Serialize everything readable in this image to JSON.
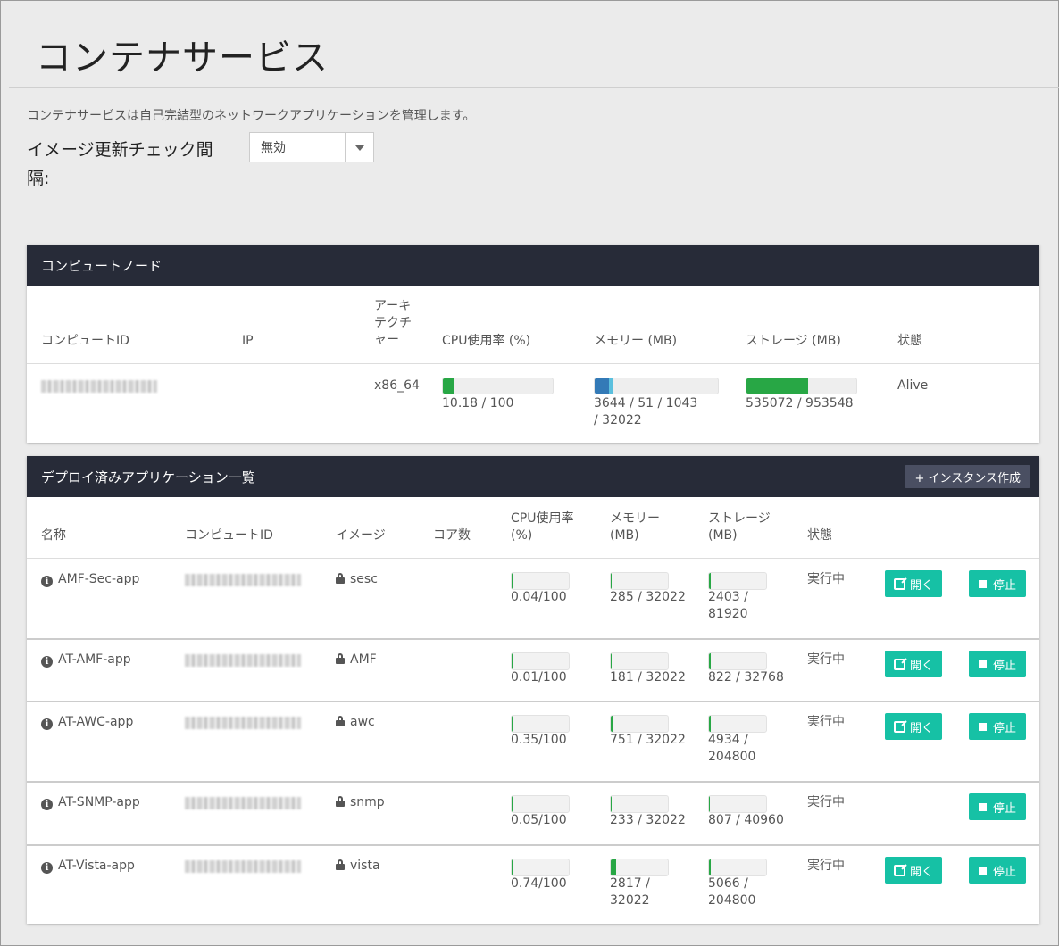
{
  "page": {
    "title": "コンテナサービス",
    "description": "コンテナサービスは自己完結型のネットワークアプリケーションを管理します。",
    "interval_label": "イメージ更新チェック間隔:",
    "interval_value": "無効"
  },
  "compute": {
    "title": "コンピュートノード",
    "headers": {
      "id": "コンピュートID",
      "ip": "IP",
      "arch": "アーキテクチャー",
      "cpu": "CPU使用率 (%)",
      "memory": "メモリー (MB)",
      "storage": "ストレージ (MB)",
      "status": "状態"
    },
    "node": {
      "arch": "x86_64",
      "cpu_text": "10.18 / 100",
      "cpu_fraction": 0.1018,
      "memory_text": "3644 / 51 / 1043 / 32022",
      "memory_fraction_used": 0.114,
      "memory_fraction_buffer": 0.033,
      "storage_text": "535072 / 953548",
      "storage_fraction": 0.561,
      "status": "Alive"
    }
  },
  "apps": {
    "title": "デプロイ済みアプリケーション一覧",
    "create_label": "+ インスタンス作成",
    "headers": {
      "name": "名称",
      "compute_id": "コンピュートID",
      "image": "イメージ",
      "cores": "コア数",
      "cpu": "CPU使用率 (%)",
      "memory": "メモリー (MB)",
      "storage": "ストレージ (MB)",
      "status": "状態"
    },
    "open_label": "開く",
    "stop_label": "停止",
    "rows": [
      {
        "name": "AMF-Sec-app",
        "image": "sesc",
        "cpu": "0.04/100",
        "cpu_fraction": 0.0004,
        "memory": "285 / 32022",
        "memory_fraction": 0.0089,
        "storage": "2403 / 81920",
        "storage_fraction": 0.0293,
        "status": "実行中",
        "has_open": true
      },
      {
        "name": "AT-AMF-app",
        "image": "AMF",
        "cpu": "0.01/100",
        "cpu_fraction": 0.0001,
        "memory": "181 / 32022",
        "memory_fraction": 0.0057,
        "storage": "822 / 32768",
        "storage_fraction": 0.0251,
        "status": "実行中",
        "has_open": true
      },
      {
        "name": "AT-AWC-app",
        "image": "awc",
        "cpu": "0.35/100",
        "cpu_fraction": 0.0035,
        "memory": "751 / 32022",
        "memory_fraction": 0.0235,
        "storage": "4934 / 204800",
        "storage_fraction": 0.0241,
        "status": "実行中",
        "has_open": true
      },
      {
        "name": "AT-SNMP-app",
        "image": "snmp",
        "cpu": "0.05/100",
        "cpu_fraction": 0.0005,
        "memory": "233 / 32022",
        "memory_fraction": 0.0073,
        "storage": "807 / 40960",
        "storage_fraction": 0.0197,
        "status": "実行中",
        "has_open": false
      },
      {
        "name": "AT-Vista-app",
        "image": "vista",
        "cpu": "0.74/100",
        "cpu_fraction": 0.0074,
        "memory": "2817 / 32022",
        "memory_fraction": 0.088,
        "storage": "5066 / 204800",
        "storage_fraction": 0.0247,
        "status": "実行中",
        "has_open": true
      }
    ]
  }
}
